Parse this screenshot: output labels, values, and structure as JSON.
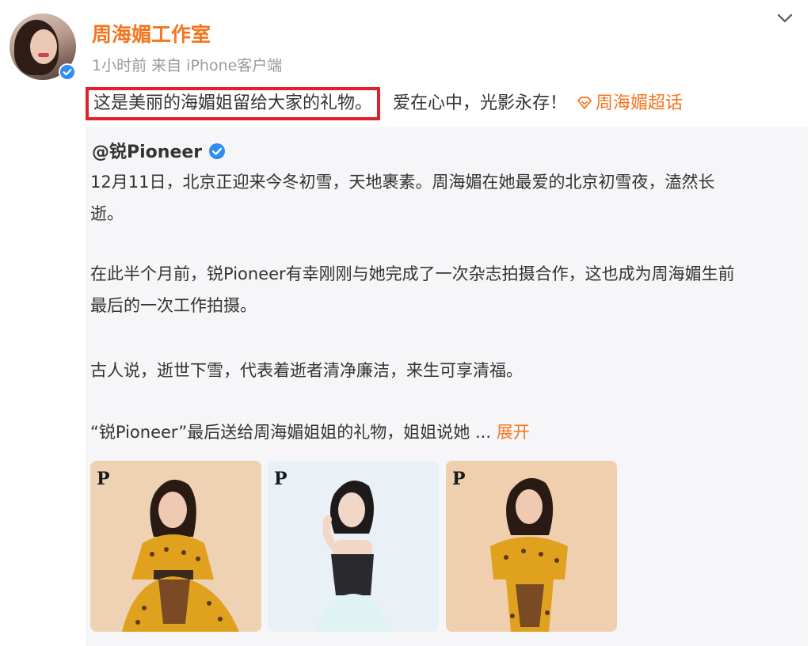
{
  "post": {
    "author_name": "周海媚工作室",
    "meta": "1小时前  来自 iPhone客户端",
    "text_highlighted": "这是美丽的海媚姐留给大家的礼物。",
    "text_rest": "爱在心中，光影永存！",
    "topic": "周海媚超话"
  },
  "repost": {
    "author": "@锐Pioneer",
    "paragraphs": [
      "12月11日，北京正迎来今冬初雪，天地裹素。周海媚在她最爱的北京初雪夜，溘然长",
      "逝。",
      "在此半个月前，锐Pioneer有幸刚刚与她完成了一次杂志拍摄合作，这也成为周海媚生前",
      "最后的一次工作拍摄。",
      "古人说，逝世下雪，代表着逝者清净廉洁，来生可享清福。",
      "“锐Pioneer”最后送给周海媚姐姐的礼物，姐姐说她 ..."
    ],
    "expand_label": "展开",
    "photo_logo": "P"
  },
  "colors": {
    "accent": "#f47520",
    "highlight_border": "#e0202a",
    "verified": "#2f8cf0",
    "repost_background": "#f6f6f8"
  },
  "icons": {
    "chevron": "chevron-down-icon",
    "verified": "verified-badge-icon",
    "topic": "diamond-topic-icon"
  }
}
